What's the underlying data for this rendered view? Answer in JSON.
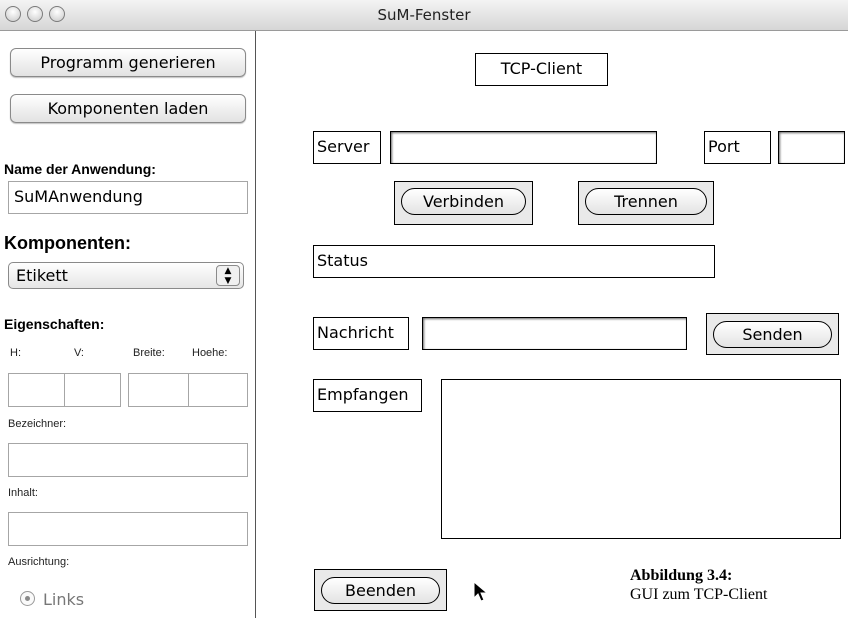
{
  "window": {
    "title": "SuM-Fenster"
  },
  "sidebar": {
    "generate_button": "Programm generieren",
    "load_button": "Komponenten laden",
    "app_name_label": "Name der Anwendung:",
    "app_name_value": "SuMAnwendung",
    "components_label": "Komponenten:",
    "component_selected": "Etikett",
    "properties_label": "Eigenschaften:",
    "col_h": "H:",
    "col_v": "V:",
    "col_breite": "Breite:",
    "col_hoehe": "Hoehe:",
    "bezeichner_label": "Bezeichner:",
    "inhalt_label": "Inhalt:",
    "ausrichtung_label": "Ausrichtung:",
    "radio_links": "Links"
  },
  "main": {
    "title": "TCP-Client",
    "server_label": "Server",
    "port_label": "Port",
    "connect_button": "Verbinden",
    "disconnect_button": "Trennen",
    "status_label": "Status",
    "message_label": "Nachricht",
    "send_button": "Senden",
    "received_label": "Empfangen",
    "quit_button": "Beenden"
  },
  "caption": {
    "title": "Abbildung 3.4:",
    "text": "GUI zum TCP-Client"
  }
}
